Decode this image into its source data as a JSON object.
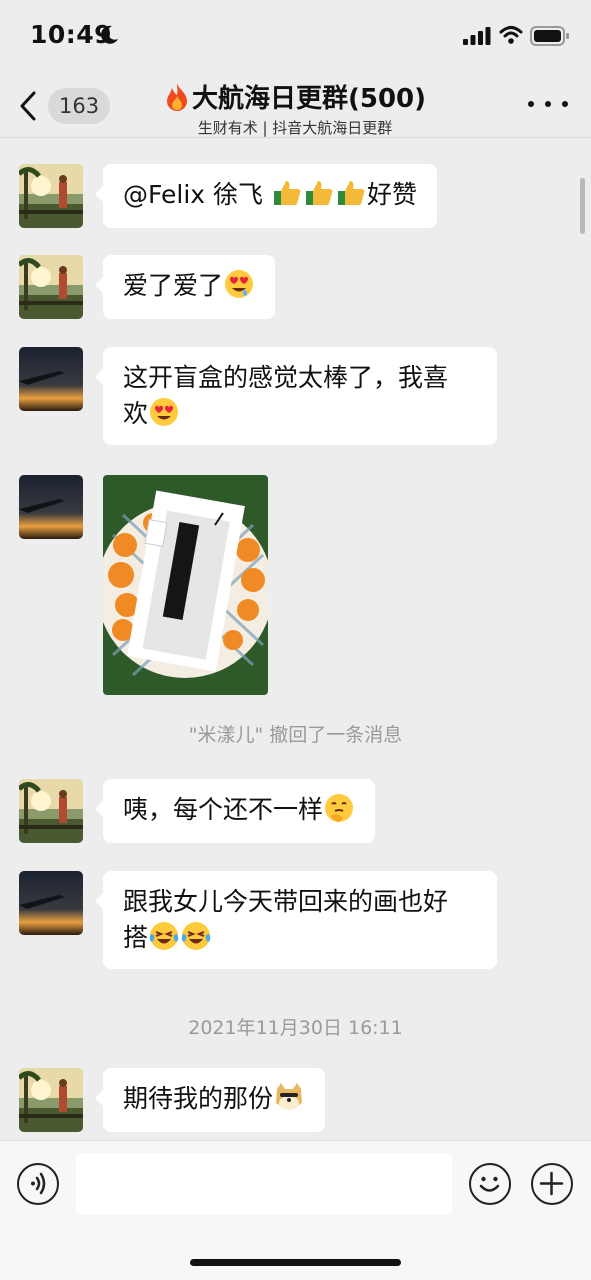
{
  "status_bar": {
    "time": "10:49"
  },
  "header": {
    "unread_count": "163",
    "title": "大航海日更群(500)",
    "subtitle": "生财有术 | 抖音大航海日更群"
  },
  "messages": [
    {
      "text": "@Felix 徐飞 ",
      "suffix": "好赞",
      "emojis": [
        "thumbs-up",
        "thumbs-up",
        "thumbs-up"
      ]
    },
    {
      "text": "爱了爱了",
      "emojis": [
        "heart-eyes-drool"
      ]
    },
    {
      "text_line1": "这开盲盒的感觉太棒了，我喜",
      "text_line2": "欢",
      "emojis": [
        "heart-eyes"
      ]
    },
    {
      "image": "blind-box-photo"
    },
    {
      "text": "咦，每个还不一样",
      "emojis": [
        "thinking-hand"
      ]
    },
    {
      "text_line1": "跟我女儿今天带回来的画也好",
      "text_line2": "搭",
      "emojis": [
        "laughing-tears",
        "laughing-tears"
      ]
    },
    {
      "text": "期待我的那份",
      "emojis": [
        "doge"
      ]
    }
  ],
  "system": {
    "recall_notice": "\"米漾儿\" 撤回了一条消息",
    "timestamp": "2021年11月30日 16:11"
  },
  "input": {
    "placeholder": ""
  }
}
